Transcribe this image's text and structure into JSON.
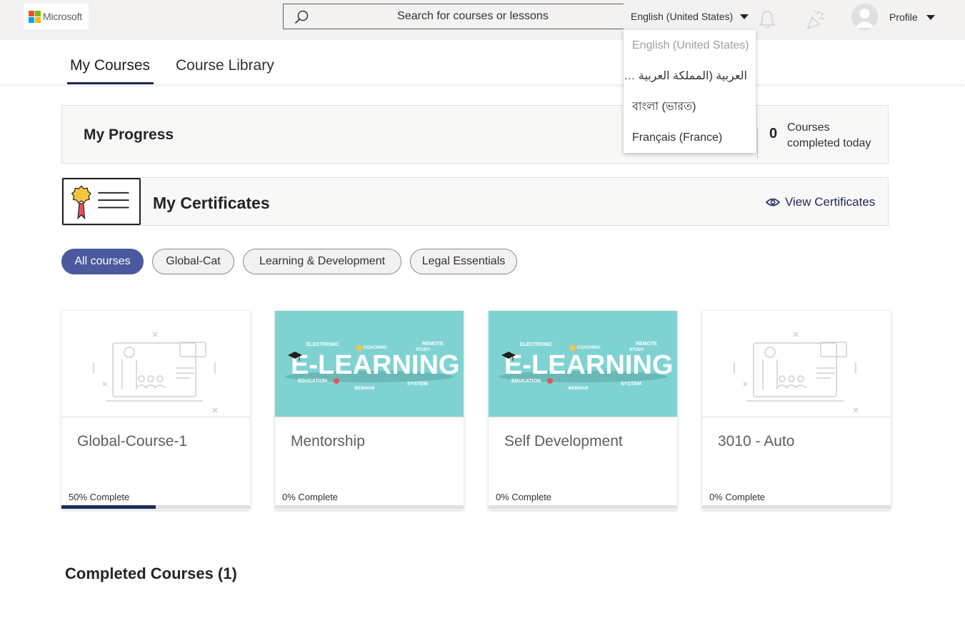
{
  "header": {
    "logo_text": "Microsoft",
    "search_placeholder": "Search for courses or lessons",
    "language_selected": "English (United States)",
    "profile_label": "Profile"
  },
  "language_menu": {
    "options": [
      "English (United States)",
      "العربية (المملكة العربية السعودية)",
      "বাংলা (ভারত)",
      "Français (France)"
    ]
  },
  "tabs": [
    {
      "label": "My Courses",
      "active": true
    },
    {
      "label": "Course Library",
      "active": false
    }
  ],
  "progress": {
    "title": "My Progress",
    "count": "0",
    "caption": "Courses completed today"
  },
  "certificates": {
    "title": "My Certificates",
    "view_label": "View Certificates"
  },
  "filters": [
    {
      "label": "All courses",
      "active": true
    },
    {
      "label": "Global-Cat",
      "active": false
    },
    {
      "label": "Learning & Development",
      "active": false
    },
    {
      "label": "Legal Essentials",
      "active": false
    }
  ],
  "courses": [
    {
      "title": "Global-Course-1",
      "progress_label": "50% Complete",
      "progress": 0.5,
      "thumbnail": "placeholder-illustration"
    },
    {
      "title": "Mentorship",
      "progress_label": "0% Complete",
      "progress": 0,
      "thumbnail": "e-learning-banner"
    },
    {
      "title": "Self Development",
      "progress_label": "0% Complete",
      "progress": 0,
      "thumbnail": "e-learning-banner"
    },
    {
      "title": "3010 - Auto",
      "progress_label": "0% Complete",
      "progress": 0,
      "thumbnail": "placeholder-illustration"
    }
  ],
  "banner_text": {
    "main": "E-LEARNING",
    "words": [
      "ELECTRONIC",
      "COACHING",
      "REMOTE",
      "STUDY",
      "EDUCATION",
      "WEBINAR",
      "SYSTEM"
    ]
  },
  "completed": {
    "title": "Completed Courses (1)"
  },
  "colors": {
    "accent": "#1b2a5c",
    "chip_active": "#4b5a9e",
    "banner": "#7ed3d2"
  }
}
